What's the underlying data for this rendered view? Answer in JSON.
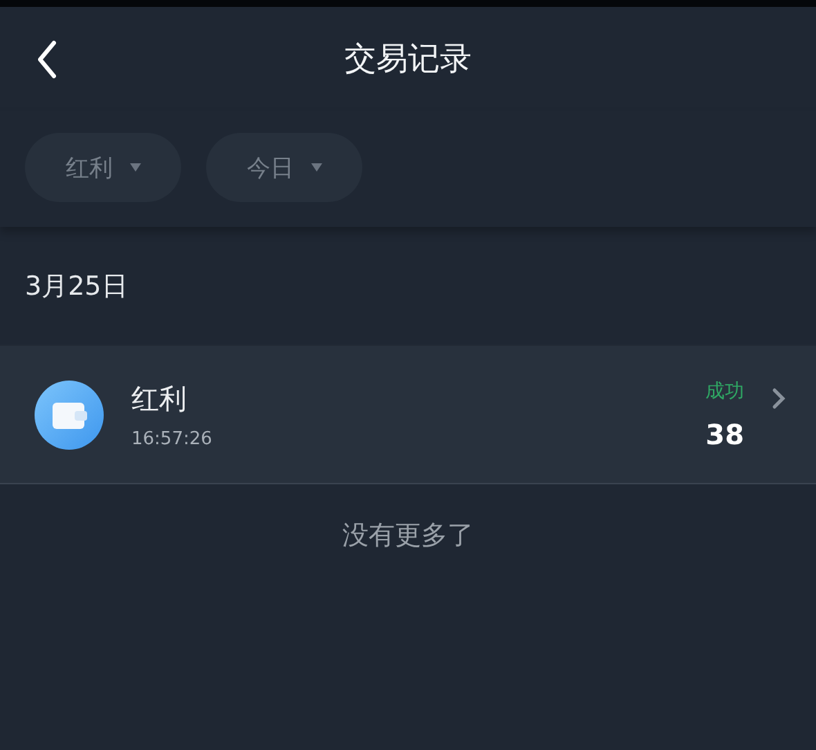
{
  "header": {
    "title": "交易记录"
  },
  "filters": [
    {
      "label": "红利"
    },
    {
      "label": "今日"
    }
  ],
  "date_group": "3月25日",
  "transactions": [
    {
      "name": "红利",
      "time": "16:57:26",
      "status": "成功",
      "succeeded": true,
      "amount": "38"
    }
  ],
  "end_note": "没有更多了"
}
